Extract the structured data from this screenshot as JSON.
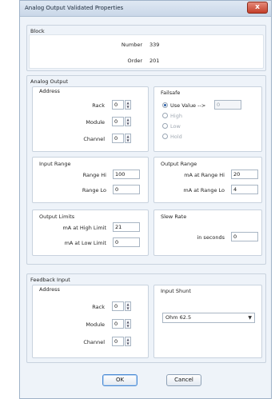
{
  "window": {
    "title": "Analog Output Validated Properties",
    "close": "x"
  },
  "block": {
    "header": "Block",
    "number_label": "Number",
    "number_value": "339",
    "order_label": "Order",
    "order_value": "201"
  },
  "analog_output": {
    "header": "Analog Output",
    "address": {
      "header": "Address",
      "rack_label": "Rack",
      "rack_value": "0",
      "module_label": "Module",
      "module_value": "0",
      "channel_label": "Channel",
      "channel_value": "0"
    },
    "failsafe": {
      "header": "Failsafe",
      "options": [
        "Use Value -->",
        "High",
        "Low",
        "Hold"
      ],
      "selected": "Use Value -->",
      "value": "0"
    },
    "input_range": {
      "header": "Input Range",
      "hi_label": "Range Hi",
      "hi_value": "100",
      "lo_label": "Range Lo",
      "lo_value": "0"
    },
    "output_range": {
      "header": "Output Range",
      "hi_label": "mA at Range Hi",
      "hi_value": "20",
      "lo_label": "mA at Range Lo",
      "lo_value": "4"
    },
    "output_limits": {
      "header": "Output Limits",
      "high_label": "mA at High Limit",
      "high_value": "21",
      "low_label": "mA at Low Limit",
      "low_value": "0"
    },
    "slew_rate": {
      "header": "Slew Rate",
      "seconds_label": "in seconds",
      "seconds_value": "0"
    }
  },
  "feedback_input": {
    "header": "Feedback Input",
    "address": {
      "header": "Address",
      "rack_label": "Rack",
      "rack_value": "0",
      "module_label": "Module",
      "module_value": "0",
      "channel_label": "Channel",
      "channel_value": "0"
    },
    "input_shunt": {
      "header": "Input Shunt",
      "selected": "Ohm  62.5"
    }
  },
  "buttons": {
    "ok": "OK",
    "cancel": "Cancel"
  }
}
